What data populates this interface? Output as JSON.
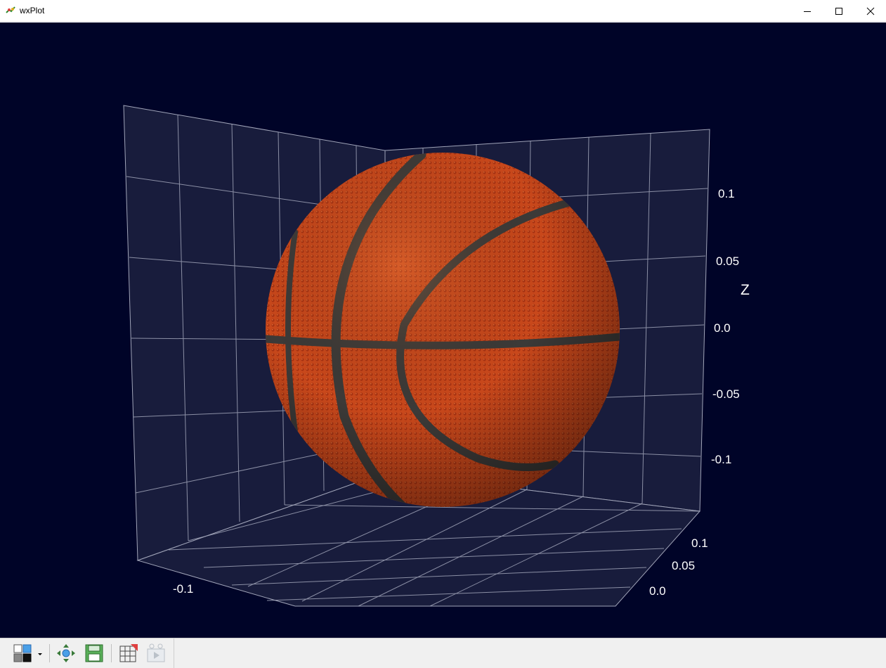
{
  "window": {
    "title": "wxPlot",
    "controls": [
      "minimize",
      "maximize",
      "close"
    ]
  },
  "plot": {
    "background_color": "#000428",
    "pane_color": "#181c3c",
    "grid_color": "#a0a4b8",
    "object": "basketball-sphere",
    "ball_color": "#c8461a",
    "seam_color": "#3c3a38",
    "axes": {
      "z": {
        "label": "Z",
        "ticks": [
          "0.1",
          "0.05",
          "0.0",
          "-0.05",
          "-0.1"
        ]
      },
      "x": {
        "ticks": [
          "-0.1"
        ]
      },
      "y": {
        "ticks": [
          "0.1",
          "0.05",
          "0.0"
        ]
      }
    }
  },
  "toolbar": {
    "buttons": [
      {
        "icon": "layout-grid-icon",
        "has_dropdown": true
      },
      {
        "icon": "reset-view-icon"
      },
      {
        "icon": "save-icon"
      },
      {
        "icon": "grid-toggle-icon"
      },
      {
        "icon": "record-video-icon",
        "disabled": true
      }
    ]
  }
}
